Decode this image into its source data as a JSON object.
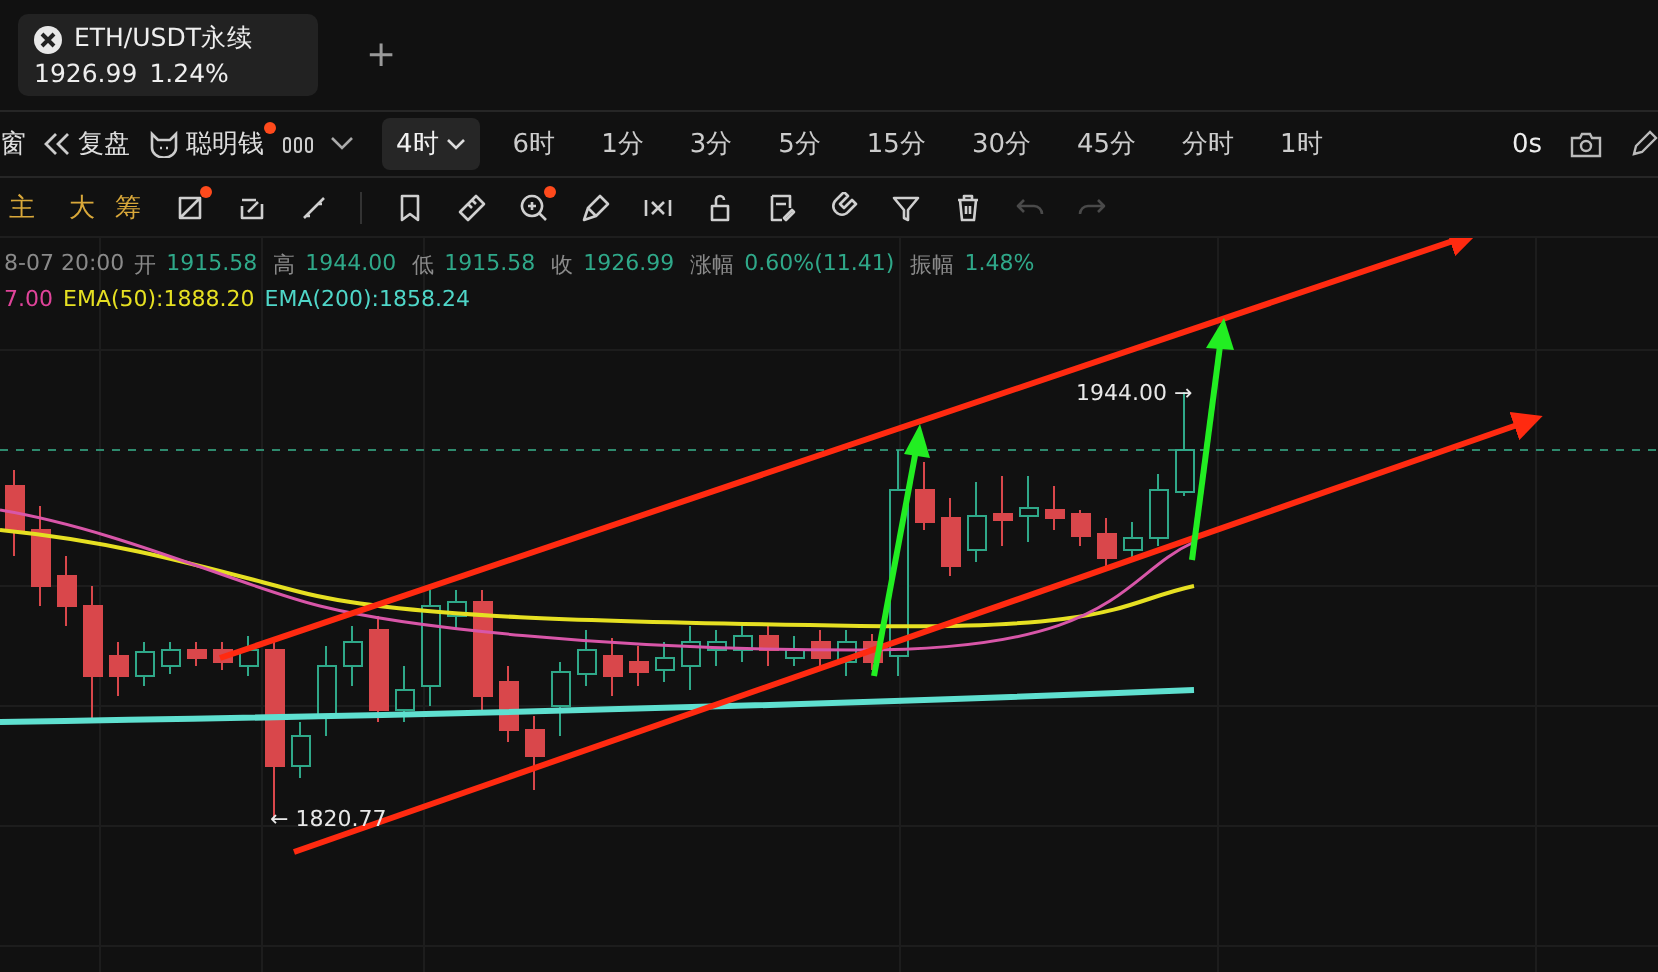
{
  "tab": {
    "symbol": "ETH/USDT永续",
    "price": "1926.99",
    "change": "1.24%"
  },
  "add_tab": "+",
  "toolbar": {
    "items": [
      {
        "kind": "text",
        "label": "窗",
        "dot": false
      },
      {
        "kind": "replay",
        "label": "复盘",
        "dot": false
      },
      {
        "kind": "smart",
        "label": "聪明钱",
        "dot": true
      }
    ],
    "intervals": [
      {
        "label": "4时",
        "selected": true
      },
      {
        "label": "6时",
        "selected": false
      },
      {
        "label": "1分",
        "selected": false
      },
      {
        "label": "3分",
        "selected": false
      },
      {
        "label": "5分",
        "selected": false
      },
      {
        "label": "15分",
        "selected": false
      },
      {
        "label": "30分",
        "selected": false
      },
      {
        "label": "45分",
        "selected": false
      },
      {
        "label": "分时",
        "selected": false
      },
      {
        "label": "1时",
        "selected": false
      }
    ],
    "countdown": "0s"
  },
  "overlays": [
    "主",
    "大",
    "筹"
  ],
  "tools": [
    {
      "kind": "cross-square",
      "dot": true,
      "disabled": false
    },
    {
      "kind": "sync-square",
      "dot": false,
      "disabled": false
    },
    {
      "kind": "line",
      "dot": false,
      "disabled": false
    },
    {
      "kind": "divider"
    },
    {
      "kind": "bookmark",
      "dot": false,
      "disabled": false
    },
    {
      "kind": "ruler",
      "dot": false,
      "disabled": false
    },
    {
      "kind": "zoom",
      "dot": true,
      "disabled": false
    },
    {
      "kind": "brush",
      "dot": false,
      "disabled": false
    },
    {
      "kind": "hide",
      "dot": false,
      "disabled": false
    },
    {
      "kind": "lock",
      "dot": false,
      "disabled": false
    },
    {
      "kind": "note",
      "dot": false,
      "disabled": false
    },
    {
      "kind": "magnet",
      "dot": false,
      "disabled": false
    },
    {
      "kind": "filter",
      "dot": false,
      "disabled": false
    },
    {
      "kind": "trash",
      "dot": false,
      "disabled": false
    },
    {
      "kind": "undo",
      "dot": false,
      "disabled": true
    },
    {
      "kind": "redo",
      "dot": false,
      "disabled": true
    }
  ],
  "ohlc": {
    "time": "8-07 20:00",
    "fields": [
      {
        "label": "开",
        "value": "1915.58"
      },
      {
        "label": "高",
        "value": "1944.00"
      },
      {
        "label": "低",
        "value": "1915.58"
      },
      {
        "label": "收",
        "value": "1926.99"
      },
      {
        "label": "涨幅",
        "value": "0.60%(11.41)"
      },
      {
        "label": "振幅",
        "value": "1.48%"
      }
    ]
  },
  "ema": [
    {
      "label": "7.00",
      "color": "#e0449a"
    },
    {
      "label": "EMA(50):1888.20",
      "color": "#e6e022"
    },
    {
      "label": "EMA(200):1858.24",
      "color": "#4fd6c8"
    }
  ],
  "chart": {
    "high_label": "1944.00 →",
    "low_label": "← 1820.77"
  }
}
